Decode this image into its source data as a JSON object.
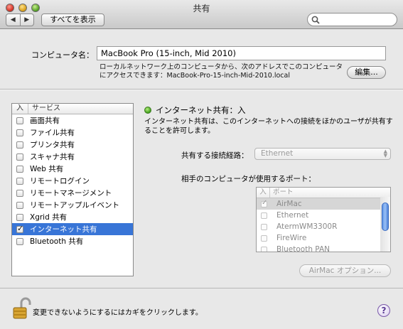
{
  "window": {
    "title": "共有"
  },
  "toolbar": {
    "back_glyph": "◀",
    "forward_glyph": "▶",
    "show_all_label": "すべてを表示"
  },
  "computer": {
    "label": "コンピュータ名：",
    "name": "MacBook Pro (15-inch, Mid 2010)",
    "description": "ローカルネットワーク上のコンピュータから、次のアドレスでこのコンピュータにアクセスできます：MacBook-Pro-15-inch-Mid-2010.local",
    "edit_label": "編集..."
  },
  "services": {
    "headers": {
      "on": "入",
      "service": "サービス"
    },
    "items": [
      {
        "label": "画面共有",
        "checked": false
      },
      {
        "label": "ファイル共有",
        "checked": false
      },
      {
        "label": "プリンタ共有",
        "checked": false
      },
      {
        "label": "スキャナ共有",
        "checked": false
      },
      {
        "label": "Web 共有",
        "checked": false
      },
      {
        "label": "リモートログイン",
        "checked": false
      },
      {
        "label": "リモートマネージメント",
        "checked": false
      },
      {
        "label": "リモートアップルイベント",
        "checked": false
      },
      {
        "label": "Xgrid 共有",
        "checked": false
      },
      {
        "label": "インターネット共有",
        "checked": true,
        "selected": true
      },
      {
        "label": "Bluetooth 共有",
        "checked": false
      }
    ]
  },
  "internet_sharing": {
    "status": "インターネット共有：入",
    "description": "インターネット共有は、このインターネットへの接続をほかのユーザが共有することを許可します。",
    "share_from_label": "共有する接続経路：",
    "share_from_value": "Ethernet",
    "ports_label": "相手のコンピュータが使用するポート：",
    "ports_headers": {
      "on": "入",
      "port": "ポート"
    },
    "ports": [
      {
        "label": "AirMac",
        "checked": true,
        "selected": true
      },
      {
        "label": "Ethernet",
        "checked": false
      },
      {
        "label": "AtermWM3300R",
        "checked": false
      },
      {
        "label": "FireWire",
        "checked": false
      },
      {
        "label": "Bluetooth PAN",
        "checked": false
      }
    ],
    "airmac_options_label": "AirMac オプション..."
  },
  "footer": {
    "lock_text": "変更できないようにするにはカギをクリックします。",
    "help_glyph": "?"
  },
  "colors": {
    "selection": "#3875d7",
    "status_green": "#3f9c1a"
  }
}
